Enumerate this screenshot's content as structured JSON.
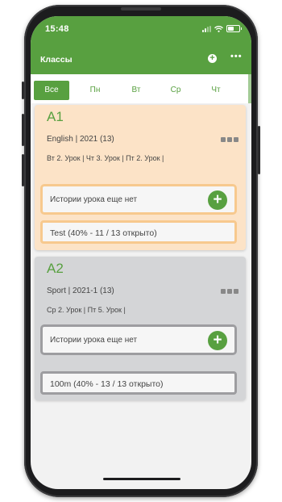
{
  "status_bar": {
    "time": "15:48",
    "icons": [
      "signal-icon",
      "wifi-icon",
      "battery-icon"
    ],
    "battery_level": 0.55
  },
  "header": {
    "title": "Классы",
    "add_icon": "plus-circle-icon",
    "more_icon": "ellipsis-icon"
  },
  "day_tabs": [
    {
      "label": "Все",
      "active": true
    },
    {
      "label": "Пн",
      "active": false
    },
    {
      "label": "Вт",
      "active": false
    },
    {
      "label": "Ср",
      "active": false
    },
    {
      "label": "Чт",
      "active": false
    }
  ],
  "classes": [
    {
      "name": "A1",
      "meta": "English | 2021 (13)",
      "schedule": "Вт 2. Урок | Чт 3. Урок | Пт 2. Урок |",
      "history_text": "Истории урока еще нет",
      "test_text": "Test (40% - 11 / 13 открыто)"
    },
    {
      "name": "A2",
      "meta": "Sport | 2021-1 (13)",
      "schedule": "Ср 2. Урок | Пт 5. Урок |",
      "history_text": "Истории урока еще нет",
      "test_text": "100m (40% - 13 / 13 открыто)"
    }
  ],
  "colors": {
    "primary": "#58a040",
    "card_orange": "#fce3c7",
    "card_gray": "#d4d5d7"
  }
}
